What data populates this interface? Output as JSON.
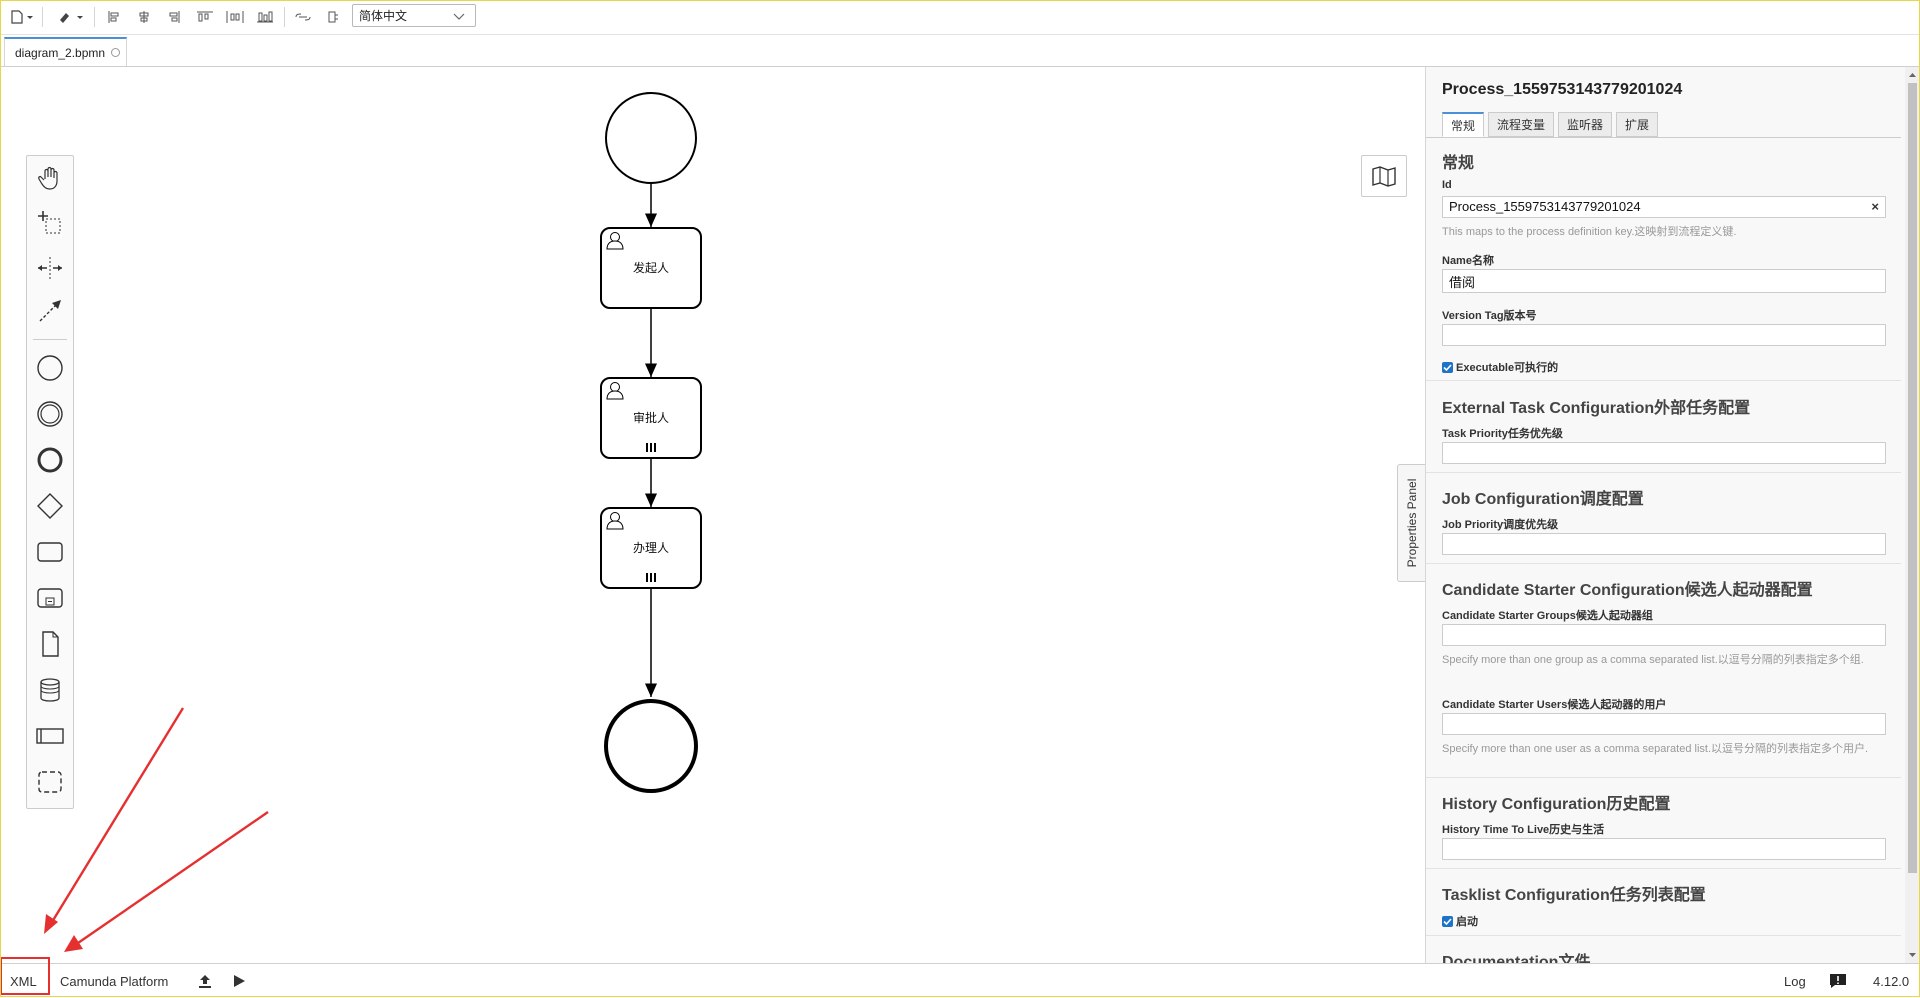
{
  "toolbar": {
    "icons": [
      "new-file-icon",
      "paint-format-icon",
      "align-left-icon",
      "align-center-icon",
      "align-right-icon",
      "distribute-horizontal-icon",
      "distribute-vertical-icon",
      "distribute-spacing-icon",
      "link-icon",
      "settings-icon"
    ],
    "language": "简体中文"
  },
  "tabs": {
    "file": "diagram_2.bpmn"
  },
  "diagram": {
    "tasks": [
      "发起人",
      "审批人",
      "办理人"
    ]
  },
  "props": {
    "title": "Process_1559753143779201024",
    "tabs": [
      "常规",
      "流程变量",
      "监听器",
      "扩展"
    ],
    "general": {
      "heading": "常规",
      "id_label": "Id",
      "id_value": "Process_1559753143779201024",
      "id_hint": "This maps to the process definition key.这映射到流程定义键.",
      "name_label": "Name名称",
      "name_value": "借阅",
      "version_label": "Version Tag版本号",
      "executable_label": "Executable可执行的"
    },
    "external": {
      "heading": "External Task Configuration外部任务配置",
      "label": "Task Priority任务优先级"
    },
    "job": {
      "heading": "Job Configuration调度配置",
      "label": "Job Priority调度优先级"
    },
    "candidate": {
      "heading": "Candidate Starter Configuration候选人起动器配置",
      "groups_label": "Candidate Starter Groups候选人起动器组",
      "groups_hint": "Specify more than one group as a comma separated list.以逗号分隔的列表指定多个组.",
      "users_label": "Candidate Starter Users候选人起动器的用户",
      "users_hint": "Specify more than one user as a comma separated list.以逗号分隔的列表指定多个用户."
    },
    "history": {
      "heading": "History Configuration历史配置",
      "label": "History Time To Live历史与生活"
    },
    "tasklist": {
      "heading": "Tasklist Configuration任务列表配置",
      "startable_label": "启动"
    },
    "documentation": {
      "heading": "Documentation文件"
    },
    "toggle_label": "Properties Panel"
  },
  "status": {
    "xml": "XML",
    "platform": "Camunda Platform",
    "log": "Log",
    "version": "4.12.0"
  },
  "colors": {
    "accent": "#4a90d9",
    "annotation": "#e53030",
    "checkbox": "#1e73c8"
  }
}
